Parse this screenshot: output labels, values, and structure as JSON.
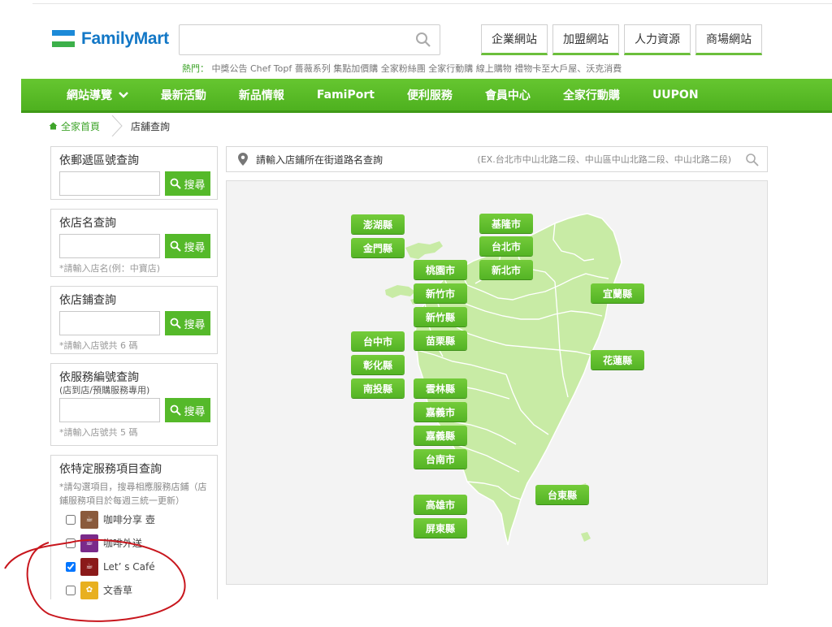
{
  "header": {
    "logo_text": "FamilyMart",
    "search": {
      "placeholder": "",
      "value": ""
    },
    "top_links": [
      "企業網站",
      "加盟網站",
      "人力資源",
      "商場網站"
    ],
    "hot_label": "熱門：",
    "hot_items": "中獎公告 Chef Topf 薔薇系列 集點加價購 全家粉絲團 全家行動購 線上購物 禮物卡至大戶屋、沃克消費"
  },
  "nav": {
    "items": [
      "網站導覽",
      "最新活動",
      "新品情報",
      "FamiPort",
      "便利服務",
      "會員中心",
      "全家行動購",
      "UUPON"
    ]
  },
  "breadcrumb": {
    "home": "全家首頁",
    "current": "店舖查詢"
  },
  "panels": {
    "zip": {
      "title": "依郵遞區號查詢",
      "button": "搜尋"
    },
    "name": {
      "title": "依店名查詢",
      "button": "搜尋",
      "hint": "*請輸入店名(例：中寶店)"
    },
    "store": {
      "title": "依店鋪查詢",
      "button": "搜尋",
      "hint": "*請輸入店號共 6 碼"
    },
    "service": {
      "title": "依服務編號查詢",
      "sub": "(店到店/預購服務專用)",
      "button": "搜尋",
      "hint": "*請輸入店號共 5 碼"
    },
    "special": {
      "title": "依特定服務項目查詢",
      "hint": "*請勾選項目，搜尋相應服務店鋪（店鋪服務項目於每週三統一更新）",
      "items": [
        {
          "label": "咖啡分享 壺",
          "checked": false,
          "color": "#8a5a3c"
        },
        {
          "label": "咖啡外送",
          "checked": false,
          "color": "#7a2a8a"
        },
        {
          "label": "Let’ s Café",
          "checked": true,
          "color": "#8b1a1a"
        },
        {
          "label": "文香草",
          "checked": false,
          "color": "#e8b020"
        }
      ]
    }
  },
  "address": {
    "label": "請輸入店鋪所在街道路名查詢",
    "example": "(EX.台北市中山北路二段、中山區中山北路二段、中山北路二段)"
  },
  "map": {
    "cities": [
      "澎湖縣",
      "金門縣",
      "基隆市",
      "台北市",
      "新北市",
      "桃園市",
      "新竹市",
      "新竹縣",
      "宜蘭縣",
      "台中市",
      "苗栗縣",
      "彰化縣",
      "花蓮縣",
      "南投縣",
      "雲林縣",
      "嘉義市",
      "嘉義縣",
      "台南市",
      "台東縣",
      "高雄市",
      "屏東縣"
    ]
  },
  "colors": {
    "brand_green": "#55b92a",
    "brand_blue": "#1277c6",
    "map_land": "#c8eba5"
  }
}
